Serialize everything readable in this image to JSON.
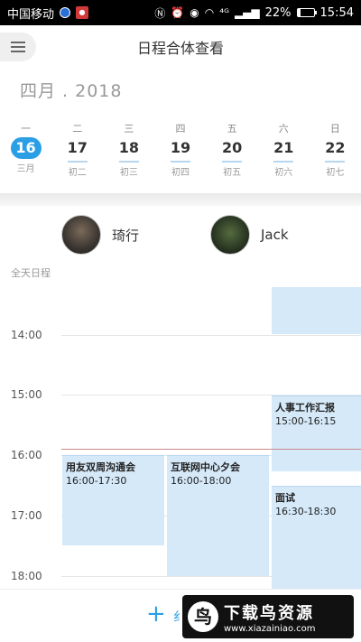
{
  "status_bar": {
    "carrier": "中国移动",
    "signal_text": "⁴ᴳ",
    "battery_percent": "22%",
    "battery_level": 0.22,
    "time": "15:54"
  },
  "header": {
    "title": "日程合体查看"
  },
  "month_label": "四月 . 2018",
  "week": [
    {
      "dow": "一",
      "day": "16",
      "lunar": "三月",
      "today": true
    },
    {
      "dow": "二",
      "day": "17",
      "lunar": "初二"
    },
    {
      "dow": "三",
      "day": "18",
      "lunar": "初三"
    },
    {
      "dow": "四",
      "day": "19",
      "lunar": "初四"
    },
    {
      "dow": "五",
      "day": "20",
      "lunar": "初五"
    },
    {
      "dow": "六",
      "day": "21",
      "lunar": "初六"
    },
    {
      "dow": "日",
      "day": "22",
      "lunar": "初七"
    }
  ],
  "people": [
    {
      "name": "琦行"
    },
    {
      "name": "Jack"
    }
  ],
  "timeline": {
    "allday_label": "全天日程",
    "hours": [
      "14:00",
      "15:00",
      "16:00",
      "17:00",
      "18:00"
    ],
    "events": [
      {
        "title": "用友双周沟通会",
        "time": "16:00-17:30"
      },
      {
        "title": "互联网中心夕会",
        "time": "16:00-18:00"
      },
      {
        "title": "人事工作汇报",
        "time": "15:00-16:15"
      },
      {
        "title": "面试",
        "time": "16:30-18:30"
      }
    ]
  },
  "bottom": {
    "add_text": "纟",
    "watermark_title": "下载鸟资源",
    "watermark_url": "www.xiazainiao.com"
  },
  "colors": {
    "accent": "#2a9fe6",
    "event_bg": "#d5e9f9",
    "now_line": "#c98a8a"
  }
}
